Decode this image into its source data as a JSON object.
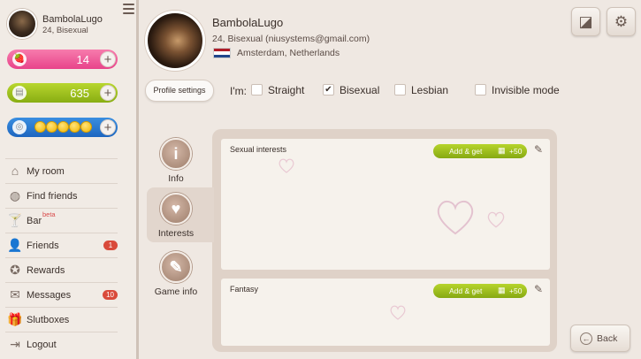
{
  "sidebar": {
    "user": {
      "name": "BambolaLugo",
      "details": "24, Bisexual"
    },
    "currencies": [
      {
        "value": "14",
        "icon": "strawberry-icon",
        "color": "#e8438a"
      },
      {
        "value": "635",
        "icon": "coins-icon",
        "color": "#88ad12"
      },
      {
        "value": "",
        "icon": "camera-icon",
        "color": "#1d66c0",
        "coin_count": 5
      }
    ],
    "nav": [
      {
        "label": "My room",
        "icon": "house-icon"
      },
      {
        "label": "Find friends",
        "icon": "globe-icon"
      },
      {
        "label": "Bar",
        "icon": "cocktail-icon",
        "tag": "beta"
      },
      {
        "label": "Friends",
        "icon": "person-icon",
        "badge": "1"
      },
      {
        "label": "Rewards",
        "icon": "reward-icon"
      },
      {
        "label": "Messages",
        "icon": "envelope-icon",
        "badge": "10"
      },
      {
        "label": "Slutboxes",
        "icon": "gift-icon"
      },
      {
        "label": "Logout",
        "icon": "logout-icon"
      }
    ]
  },
  "profile": {
    "name": "BambolaLugo",
    "details": "24, Bisexual (niusystems@gmail.com)",
    "location": "Amsterdam, Netherlands",
    "flag_colors": [
      "#ae1c28",
      "#ffffff",
      "#21468b"
    ]
  },
  "settings": {
    "button": "Profile settings",
    "im_label": "I'm:",
    "options": [
      {
        "label": "Straight",
        "checked": false
      },
      {
        "label": "Bisexual",
        "checked": true
      },
      {
        "label": "Lesbian",
        "checked": false
      },
      {
        "label": "Invisible mode",
        "checked": false
      }
    ]
  },
  "tabs": [
    {
      "label": "Info",
      "icon": "info-icon",
      "active": false
    },
    {
      "label": "Interests",
      "icon": "heart-icon",
      "active": true
    },
    {
      "label": "Game info",
      "icon": "controller-icon",
      "active": false
    }
  ],
  "sections": [
    {
      "title": "Sexual interests",
      "add_label": "Add & get",
      "reward": "+50"
    },
    {
      "title": "Fantasy",
      "add_label": "Add & get",
      "reward": "+50"
    }
  ],
  "back": "Back",
  "colors": {
    "accent_green": "#88ad12",
    "accent_pink": "#e8438a",
    "accent_blue": "#1d66c0",
    "badge_red": "#d94a3a"
  }
}
